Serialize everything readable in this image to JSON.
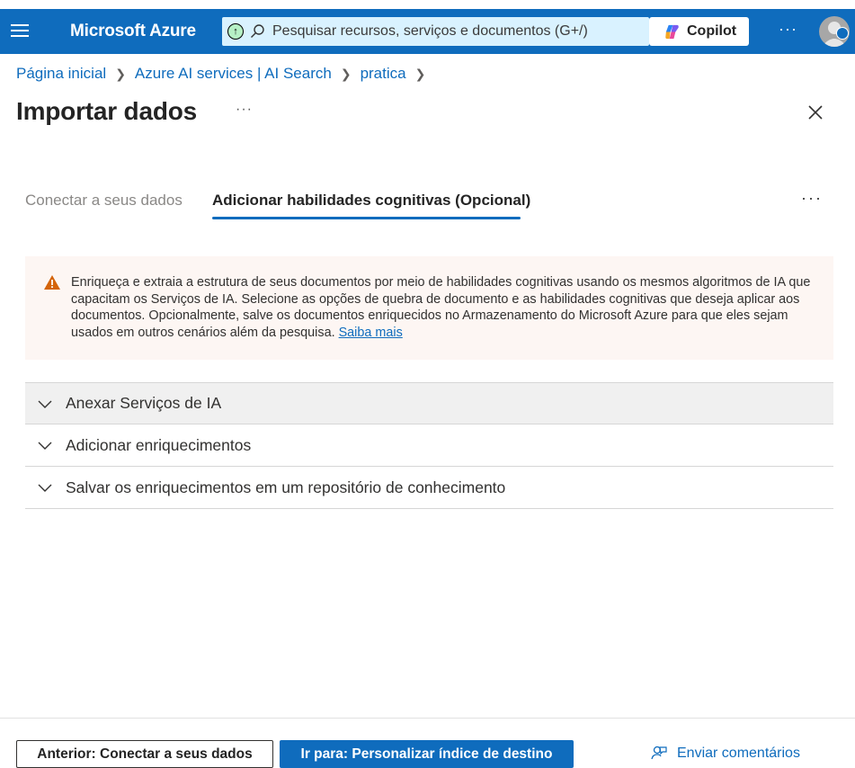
{
  "topbar": {
    "brand": "Microsoft Azure",
    "search_placeholder": "Pesquisar recursos, serviços e documentos (G+/)",
    "copilot_label": "Copilot",
    "more_label": "···"
  },
  "breadcrumb": {
    "items": [
      "Página inicial",
      "Azure AI services | AI Search",
      "pratica"
    ]
  },
  "page": {
    "title": "Importar dados",
    "title_more": "···"
  },
  "tabs": {
    "items": [
      {
        "label": "Conectar a seus dados",
        "active": false
      },
      {
        "label": "Adicionar habilidades cognitivas (Opcional)",
        "active": true
      }
    ],
    "more": "···"
  },
  "warning": {
    "text": "Enriqueça e extraia a estrutura de seus documentos por meio de habilidades cognitivas usando os mesmos algoritmos de IA que capacitam os Serviços de IA. Selecione as opções de quebra de documento e as habilidades cognitivas que deseja aplicar aos documentos. Opcionalmente, salve os documentos enriquecidos no Armazenamento do Microsoft Azure para que eles sejam usados em outros cenários além da pesquisa. ",
    "link": "Saiba mais"
  },
  "accordion": {
    "sections": [
      {
        "label": "Anexar Serviços de IA"
      },
      {
        "label": "Adicionar enriquecimentos"
      },
      {
        "label": "Salvar os enriquecimentos em um repositório de conhecimento"
      }
    ]
  },
  "footer": {
    "prev_label": "Anterior: Conectar a seus dados",
    "next_label": "Ir para: Personalizar índice de destino",
    "feedback_label": "Enviar comentários"
  },
  "colors": {
    "accent": "#0f6cbd",
    "warning_bg": "#fdf6f3",
    "warning_icon": "#d4640a"
  }
}
